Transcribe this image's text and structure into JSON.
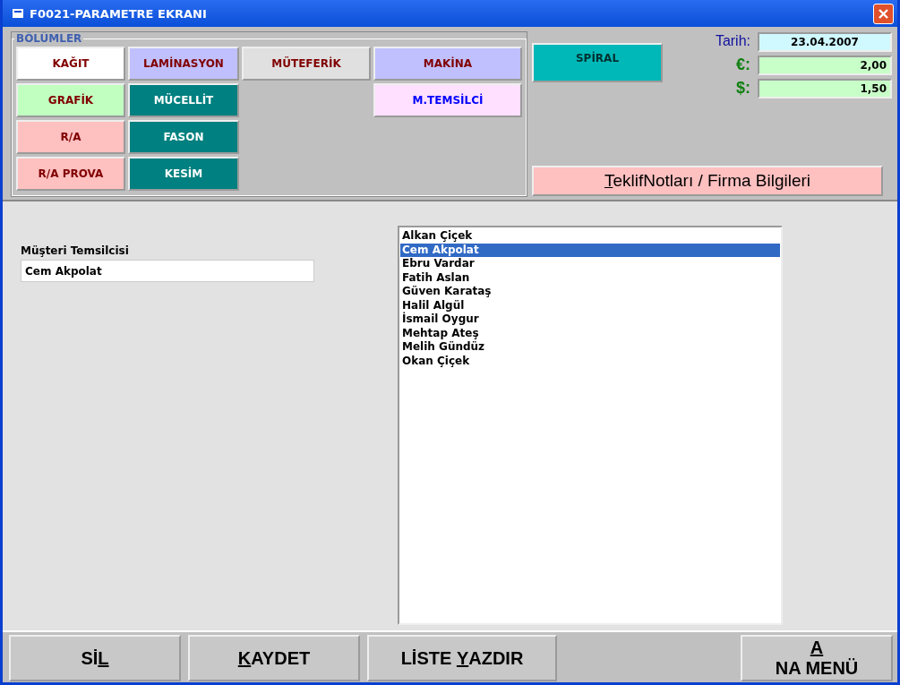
{
  "window": {
    "title": "F0021-PARAMETRE EKRANI"
  },
  "sections": {
    "legend": "BÖLÜMLER",
    "columns": [
      [
        {
          "label": "KAĞIT",
          "color": "#ffffff",
          "kind": "light"
        },
        {
          "label": "GRAFİK",
          "color": "#c0ffc0",
          "kind": "light"
        },
        {
          "label": "R/A",
          "color": "#ffc0c0",
          "kind": "light"
        },
        {
          "label": "R/A PROVA",
          "color": "#ffc0c0",
          "kind": "light"
        }
      ],
      [
        {
          "label": "LAMİNASYON",
          "color": "#c0c0ff",
          "kind": "light"
        },
        {
          "label": "MÜCELLİT",
          "color": "#008080",
          "kind": "dark"
        },
        {
          "label": "FASON",
          "color": "#008080",
          "kind": "dark"
        },
        {
          "label": "KESİM",
          "color": "#008080",
          "kind": "dark"
        }
      ],
      [
        {
          "label": "MÜTEFERİK",
          "color": "#e0e0e0",
          "kind": "light"
        }
      ],
      [
        {
          "label": "MAKİNA",
          "color": "#c0c0ff",
          "kind": "light"
        },
        {
          "label": "M.TEMSİLCİ",
          "color": "#ffe0ff",
          "kind": "active"
        }
      ]
    ]
  },
  "spiral_button": {
    "label": "SPİRAL"
  },
  "rates": [
    {
      "label": "Tarih:",
      "value": "23.04.2007",
      "kind": "date"
    },
    {
      "label": "€:",
      "value": "2,00",
      "kind": "currency"
    },
    {
      "label": "$:",
      "value": "1,50",
      "kind": "currency"
    }
  ],
  "notes_button": {
    "parts": [
      {
        "text": "T",
        "underlined": true
      },
      {
        "text": "eklifNotları / Firma Bilgileri",
        "underlined": false
      }
    ]
  },
  "representative": {
    "label": "Müşteri Temsilcisi",
    "value": "Cem Akpolat"
  },
  "list": [
    {
      "name": "Alkan Çiçek",
      "selected": false
    },
    {
      "name": "Cem Akpolat",
      "selected": true
    },
    {
      "name": "Ebru Vardar",
      "selected": false
    },
    {
      "name": "Fatih Aslan",
      "selected": false
    },
    {
      "name": "Güven Karataş",
      "selected": false
    },
    {
      "name": "Halil Algül",
      "selected": false
    },
    {
      "name": "İsmail Oygur",
      "selected": false
    },
    {
      "name": "Mehtap Ateş",
      "selected": false
    },
    {
      "name": "Melih Gündüz",
      "selected": false
    },
    {
      "name": "Okan Çiçek",
      "selected": false
    }
  ],
  "footer_buttons": [
    {
      "kind": "left",
      "parts": [
        {
          "text": "Sİ",
          "underlined": false
        },
        {
          "text": "L",
          "underlined": true
        }
      ]
    },
    {
      "kind": "left",
      "parts": [
        {
          "text": "K",
          "underlined": true
        },
        {
          "text": "AYDET",
          "underlined": false
        }
      ]
    },
    {
      "kind": "left",
      "parts": [
        {
          "text": "LİSTE ",
          "underlined": false
        },
        {
          "text": "Y",
          "underlined": true
        },
        {
          "text": "AZDIR",
          "underlined": false
        }
      ]
    },
    {
      "kind": "right",
      "parts": [
        {
          "text": "A",
          "underlined": true
        },
        {
          "text": "NA MENÜ",
          "underlined": false
        }
      ]
    }
  ]
}
